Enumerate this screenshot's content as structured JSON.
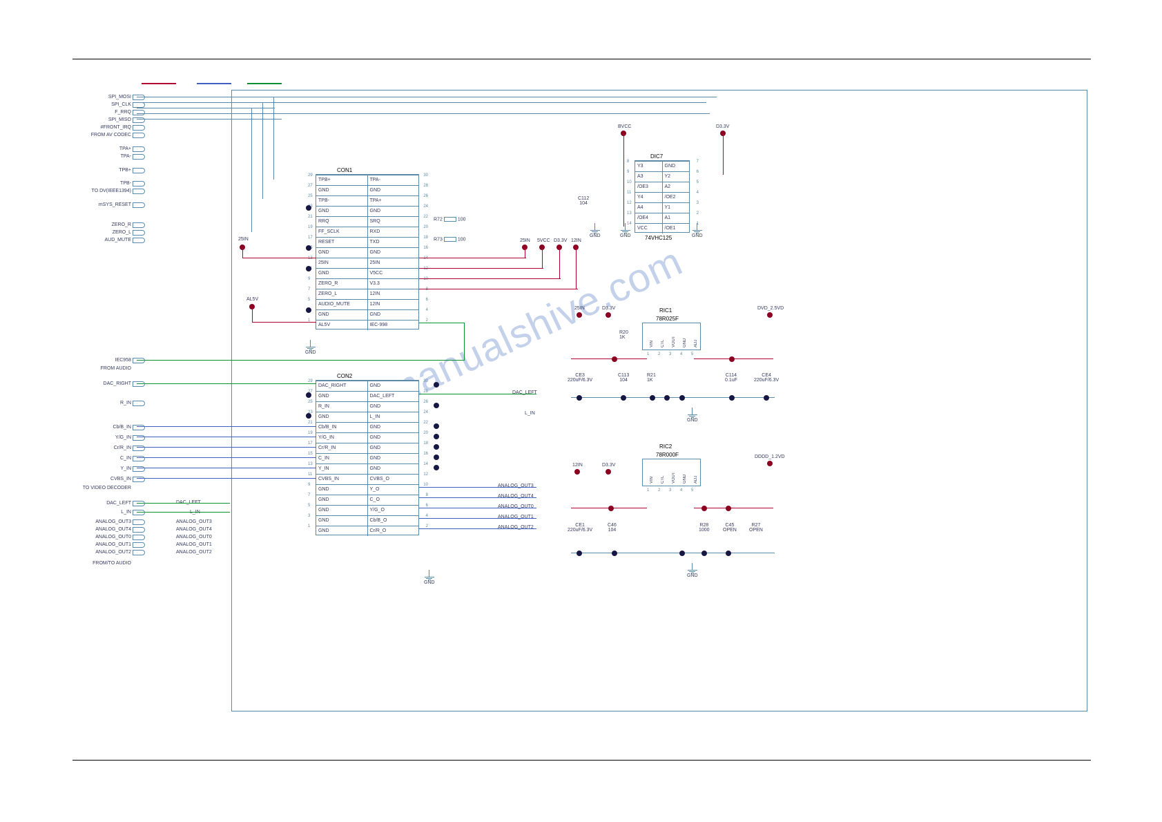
{
  "watermark": "manualshive.com",
  "legend": {
    "red": "",
    "blue": "",
    "green": ""
  },
  "left_signals_top": [
    "SPI_MOSI",
    "SPI_CLK",
    "F_RRQ",
    "SPI_MISO",
    "#FRONT_IRQ",
    "FROM AV CODEC",
    "",
    "TPA+",
    "TPA-",
    "",
    "TPB+",
    "",
    "TPB-",
    "TO DV(IEEE1394)",
    "",
    "mSYS_RESET",
    "",
    "",
    "ZERO_R",
    "ZERO_L",
    "AUD_MUTE"
  ],
  "left_signals_mid": [
    "IEC958",
    "FROM AUDIO",
    "",
    "DAC_RIGHT",
    "",
    "R_IN",
    "",
    "Cb/B_IN",
    "Y/G_IN",
    "Cr/R_IN",
    "C_IN",
    "Y_IN",
    "CVBS_IN",
    "TO VIDEO DECODER",
    "",
    "DAC_LEFT",
    "L_IN",
    "ANALOG_OUT3",
    "ANALOG_OUT4",
    "ANALOG_OUT0",
    "ANALOG_OUT1",
    "ANALOG_OUT2",
    "FROM/TO AUDIO"
  ],
  "con1": {
    "name": "CON1",
    "rows": [
      [
        "TPB+",
        "TPA-"
      ],
      [
        "GND",
        "GND"
      ],
      [
        "TPB-",
        "TPA+"
      ],
      [
        "GND",
        "GND"
      ],
      [
        "RRQ",
        "SRQ"
      ],
      [
        "FF_SCLK",
        "RXD"
      ],
      [
        "RESET",
        "TXD"
      ],
      [
        "GND",
        "GND"
      ],
      [
        "25IN",
        "25IN"
      ],
      [
        "GND",
        "V5CC"
      ],
      [
        "ZERO_R",
        "V3.3"
      ],
      [
        "ZERO_L",
        "12IN"
      ],
      [
        "AUDIO_MUTE",
        "12IN"
      ],
      [
        "GND",
        "GND"
      ],
      [
        "AL5V",
        "IEC-998"
      ]
    ],
    "pin_left": [
      "29",
      "27",
      "25",
      "23",
      "21",
      "19",
      "17",
      "15",
      "13",
      "11",
      "9",
      "7",
      "5",
      "3",
      "1"
    ],
    "pin_right": [
      "30",
      "28",
      "26",
      "24",
      "22",
      "20",
      "18",
      "16",
      "14",
      "12",
      "10",
      "8",
      "6",
      "4",
      "2"
    ]
  },
  "con2": {
    "name": "CON2",
    "rows": [
      [
        "DAC_RIGHT",
        "GND"
      ],
      [
        "GND",
        "DAC_LEFT"
      ],
      [
        "R_IN",
        "GND"
      ],
      [
        "GND",
        "L_IN"
      ],
      [
        "Cb/B_IN",
        "GND"
      ],
      [
        "Y/G_IN",
        "GND"
      ],
      [
        "Cr/R_IN",
        "GND"
      ],
      [
        "C_IN",
        "GND"
      ],
      [
        "Y_IN",
        "GND"
      ],
      [
        "CVBS_IN",
        "CVBS_O"
      ],
      [
        "GND",
        "Y_O"
      ],
      [
        "GND",
        "C_O"
      ],
      [
        "GND",
        "Y/G_O"
      ],
      [
        "GND",
        "Cb/B_O"
      ],
      [
        "GND",
        "Cr/R_O"
      ]
    ],
    "pin_left": [
      "29",
      "27",
      "25",
      "23",
      "21",
      "19",
      "17",
      "15",
      "13",
      "11",
      "9",
      "7",
      "5",
      "3",
      "1"
    ],
    "pin_right": [
      "30",
      "28",
      "26",
      "24",
      "22",
      "20",
      "18",
      "16",
      "14",
      "12",
      "10",
      "8",
      "6",
      "4",
      "2"
    ]
  },
  "dic7": {
    "name": "DIC7",
    "part": "74VHC125",
    "rows": [
      [
        "Y3",
        "GND"
      ],
      [
        "A3",
        "Y2"
      ],
      [
        "/OE3",
        "A2"
      ],
      [
        "Y4",
        "/OE2"
      ],
      [
        "A4",
        "Y1"
      ],
      [
        "/OE4",
        "A1"
      ],
      [
        "VCC",
        "/OE1"
      ]
    ],
    "pin_left": [
      "8",
      "9",
      "10",
      "11",
      "12",
      "13",
      "14"
    ],
    "pin_right": [
      "7",
      "6",
      "5",
      "4",
      "3",
      "2",
      "1"
    ]
  },
  "ric1": {
    "name": "RIC1",
    "part": "78R025F",
    "pins": [
      "VIN",
      "CTL",
      "VOUT",
      "GND",
      "ADJ"
    ],
    "pin_nums": [
      "1",
      "2",
      "3",
      "4",
      "5"
    ],
    "in_label": "25IN",
    "rail_in": "D3.3V",
    "rail_out": "DVD_2.5VD",
    "r20": "R20\n1K",
    "r21": "R21\n1K",
    "ce3": "CE3\n220uF/6.3V",
    "c113": "C113\n104",
    "c114": "C114\n0.1uF",
    "ce4": "CE4\n220uF/6.3V"
  },
  "ric2": {
    "name": "RIC2",
    "part": "78R000F",
    "pins": [
      "VIN",
      "CTL",
      "VOUT",
      "GND",
      "ADJ"
    ],
    "pin_nums": [
      "1",
      "2",
      "3",
      "4",
      "5"
    ],
    "in_label": "12IN",
    "rail_in": "D3.3V",
    "rail_out": "DDDD_1.2VD",
    "ce1": "CE1\n220uF/6.3V",
    "c46": "C46\n104",
    "r28": "R28\n1000",
    "c45": "C45\nOPEN",
    "r27": "R27\nOPEN"
  },
  "net_labels": {
    "r72": "R72",
    "r72_val": "100",
    "r73": "R73",
    "r73_val": "100",
    "c112": "C112\n104",
    "rails_top": [
      "25IN",
      "5VCC",
      "D3.3V",
      "12IN"
    ],
    "dac_left": "DAC_LEFT",
    "l_in": "L_IN",
    "analog_out": [
      "ANALOG_OUT3",
      "ANALOG_OUT4",
      "ANALOG_OUT0",
      "ANALOG_OUT1",
      "ANALOG_OUT2"
    ],
    "gnd": "GND",
    "d33v": "D3.3V",
    "bvcc": "BVCC",
    "al5v": "AL5V",
    "p5in": "25IN"
  }
}
